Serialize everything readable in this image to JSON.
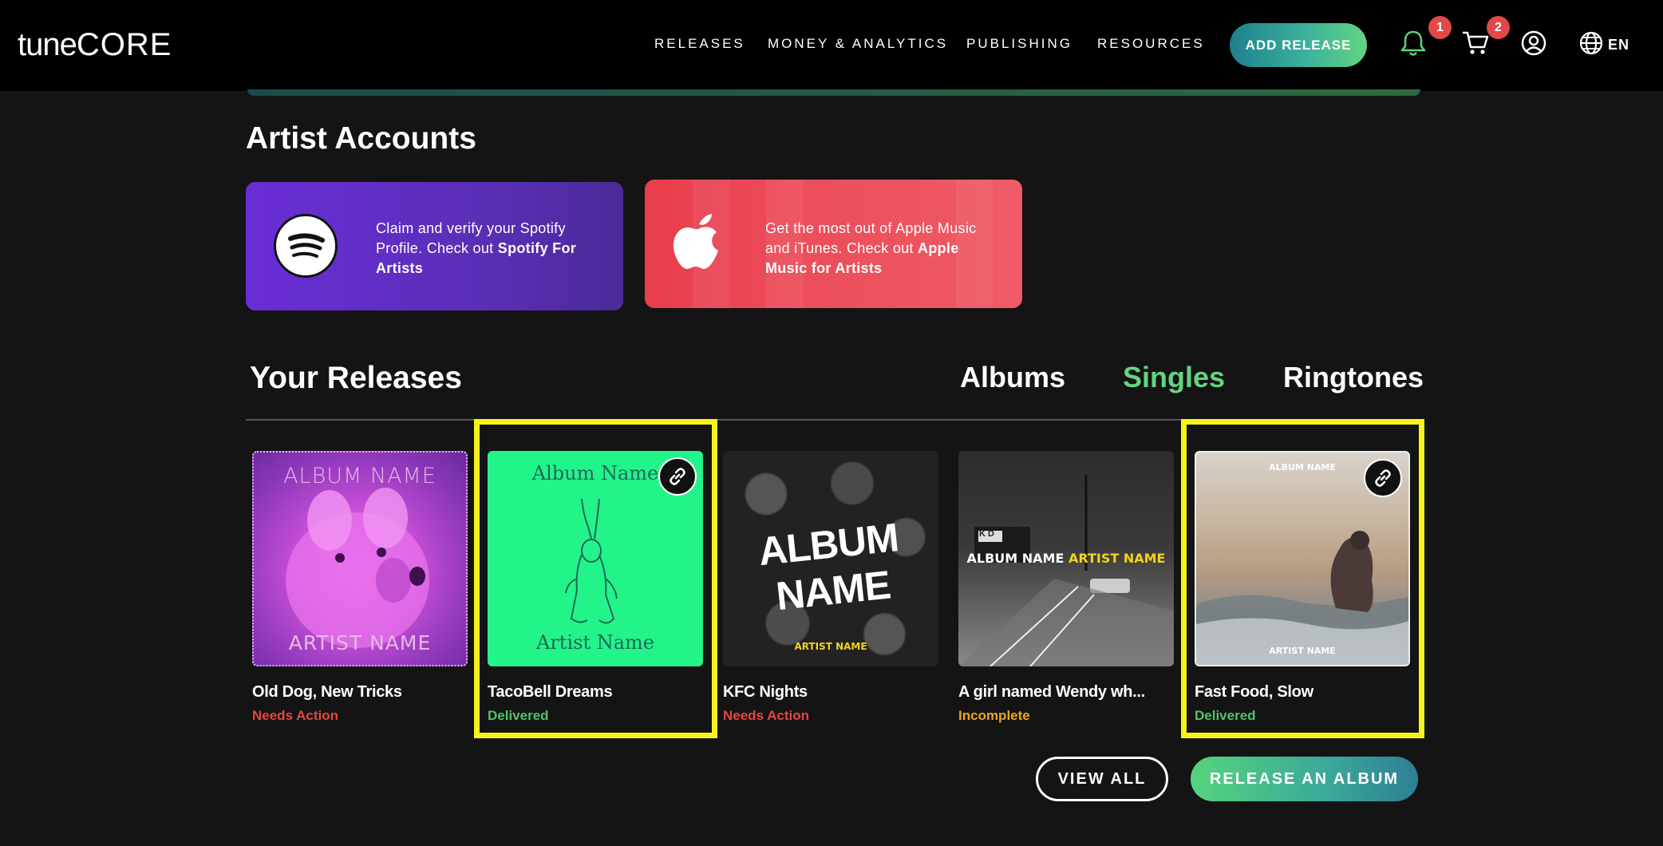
{
  "header": {
    "logo_tune": "tune",
    "logo_core": "CORE",
    "nav": [
      "RELEASES",
      "MONEY & ANALYTICS",
      "PUBLISHING",
      "RESOURCES"
    ],
    "add_release": "ADD RELEASE",
    "notifications_count": "1",
    "cart_count": "2",
    "language": "EN",
    "icons": [
      "bell-icon",
      "cart-icon",
      "user-icon",
      "globe-icon"
    ]
  },
  "artist_accounts": {
    "title": "Artist Accounts",
    "spotify": {
      "line1": "Claim and verify your Spotify",
      "line2a": "Profile. Check out ",
      "line2b": "Spotify For",
      "line3": "Artists"
    },
    "apple": {
      "line1": "Get the most out of Apple Music",
      "line2a": "and iTunes. Check out ",
      "line2b": "Apple",
      "line3": "Music for Artists"
    }
  },
  "releases": {
    "title": "Your Releases",
    "tabs": {
      "albums": "Albums",
      "singles": "Singles",
      "ringtones": "Ringtones",
      "active": "Singles"
    },
    "items": [
      {
        "title": "Old Dog, New Tricks",
        "status": "Needs Action",
        "status_color": "#e5473f",
        "cover_top": "ALBUM NAME",
        "cover_bottom": "ARTIST NAME"
      },
      {
        "title": "TacoBell Dreams",
        "status": "Delivered",
        "status_color": "#4fc46b",
        "cover_top": "Album Name",
        "cover_bottom": "Artist Name"
      },
      {
        "title": "KFC Nights",
        "status": "Needs Action",
        "status_color": "#e5473f",
        "cover_top": "ALBUM NAME",
        "cover_bottom": "ARTIST NAME"
      },
      {
        "title": "A girl named Wendy wh...",
        "status": "Incomplete",
        "status_color": "#f0a41f",
        "cover_top": "ALBUM NAME",
        "cover_top2": "ARTIST NAME",
        "cover_sign": "K D"
      },
      {
        "title": "Fast Food, Slow",
        "status": "Delivered",
        "status_color": "#4fc46b",
        "cover_top": "ALBUM NAME",
        "cover_bottom": "ARTIST NAME"
      }
    ],
    "view_all": "VIEW ALL",
    "release_album": "RELEASE AN ALBUM"
  },
  "colors": {
    "accent_green": "#62d481",
    "highlight": "#f6f21a",
    "bg": "#141414"
  }
}
